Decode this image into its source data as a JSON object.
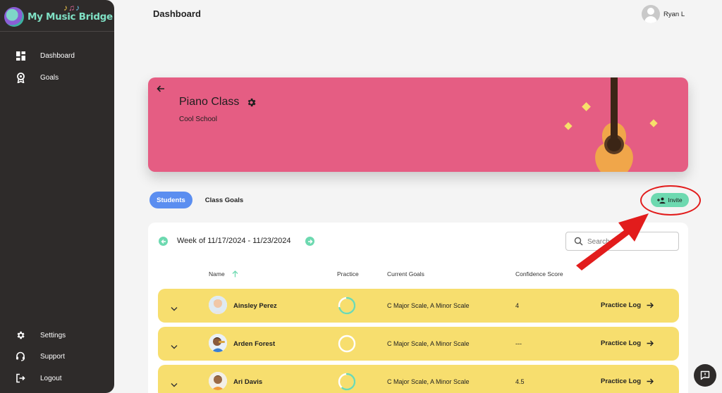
{
  "app": {
    "name": "My Music Bridge"
  },
  "sidebar": {
    "items": [
      {
        "label": "Dashboard",
        "icon": "dashboard-icon"
      },
      {
        "label": "Goals",
        "icon": "award-icon"
      }
    ],
    "bottom_items": [
      {
        "label": "Settings",
        "icon": "gear-icon"
      },
      {
        "label": "Support",
        "icon": "headset-icon"
      },
      {
        "label": "Logout",
        "icon": "logout-icon"
      }
    ]
  },
  "header": {
    "title": "Dashboard",
    "user_name": "Ryan L"
  },
  "banner": {
    "title": "Piano Class",
    "school": "Cool School",
    "color": "#e55d83"
  },
  "tabs": [
    {
      "label": "Students",
      "active": true
    },
    {
      "label": "Class Goals",
      "active": false
    }
  ],
  "invite_label": "Invite",
  "week": {
    "label": "Week of 11/17/2024 - 11/23/2024"
  },
  "search": {
    "placeholder": "Search"
  },
  "table": {
    "columns": [
      "Name",
      "Practice",
      "Current Goals",
      "Confidence Score"
    ],
    "sort_column": "Name",
    "rows": [
      {
        "name": "Ainsley Perez",
        "practice_progress": 0.7,
        "goals": "C Major Scale, A Minor Scale",
        "score": "4",
        "action": "Practice Log"
      },
      {
        "name": "Arden Forest",
        "practice_progress": 0,
        "goals": "C Major Scale, A Minor Scale",
        "score": "---",
        "action": "Practice Log"
      },
      {
        "name": "Ari Davis",
        "practice_progress": 0.6,
        "goals": "C Major Scale, A Minor Scale",
        "score": "4.5",
        "action": "Practice Log"
      }
    ]
  },
  "colors": {
    "accent": "#5b8ef0",
    "mint": "#6dd9b0",
    "row": "#f7de6e",
    "sidebar": "#2e2b2a"
  }
}
